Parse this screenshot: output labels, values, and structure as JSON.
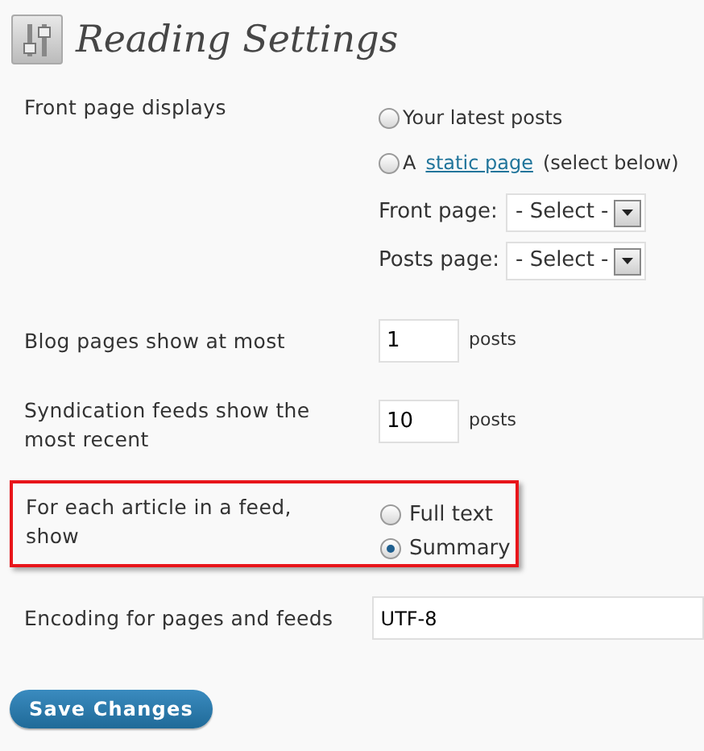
{
  "title": "Reading Settings",
  "front_page": {
    "label": "Front page displays",
    "options": [
      {
        "before": "Your latest posts",
        "selected": false
      },
      {
        "before": "A",
        "link": "static page",
        "after": "(select below)",
        "selected": false
      }
    ],
    "selects": [
      {
        "label": "Front page:",
        "value": "- Select -"
      },
      {
        "label": "Posts page:",
        "value": "- Select -"
      }
    ]
  },
  "blog_pages": {
    "label": "Blog pages show at most",
    "value": "1",
    "unit": "posts"
  },
  "syndication": {
    "label": "Syndication feeds show the most recent",
    "value": "10",
    "unit": "posts"
  },
  "feed_article": {
    "label": "For each article in a feed, show",
    "highlighted": true,
    "options": [
      {
        "label": "Full text",
        "selected": false
      },
      {
        "label": "Summary",
        "selected": true
      }
    ]
  },
  "encoding": {
    "label": "Encoding for pages and feeds",
    "value": "UTF-8"
  },
  "save_button": "Save Changes"
}
